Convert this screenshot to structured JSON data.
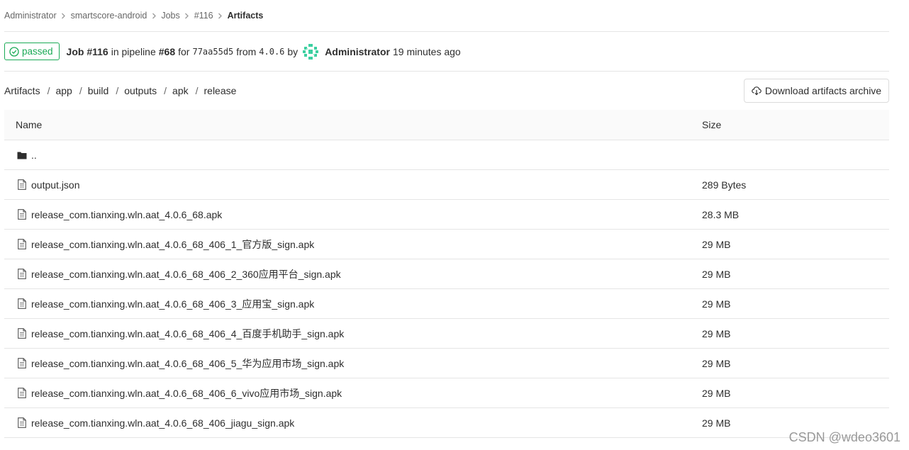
{
  "breadcrumb": [
    "Administrator",
    "smartscore-android",
    "Jobs",
    "#116",
    "Artifacts"
  ],
  "job": {
    "status": "passed",
    "job_label": "Job #116",
    "in_pipeline": "in pipeline",
    "pipeline": "#68",
    "for_text": "for",
    "commit": "77aa55d5",
    "from_text": "from",
    "ref": "4.0.6",
    "by_text": "by",
    "user": "Administrator",
    "time": "19 minutes ago"
  },
  "path": [
    "Artifacts",
    "app",
    "build",
    "outputs",
    "apk",
    "release"
  ],
  "download_label": "Download artifacts archive",
  "table": {
    "headers": {
      "name": "Name",
      "size": "Size"
    },
    "parent": "..",
    "rows": [
      {
        "name": "output.json",
        "size": "289 Bytes"
      },
      {
        "name": "release_com.tianxing.wln.aat_4.0.6_68.apk",
        "size": "28.3 MB"
      },
      {
        "name": "release_com.tianxing.wln.aat_4.0.6_68_406_1_官方版_sign.apk",
        "size": "29 MB"
      },
      {
        "name": "release_com.tianxing.wln.aat_4.0.6_68_406_2_360应用平台_sign.apk",
        "size": "29 MB"
      },
      {
        "name": "release_com.tianxing.wln.aat_4.0.6_68_406_3_应用宝_sign.apk",
        "size": "29 MB"
      },
      {
        "name": "release_com.tianxing.wln.aat_4.0.6_68_406_4_百度手机助手_sign.apk",
        "size": "29 MB"
      },
      {
        "name": "release_com.tianxing.wln.aat_4.0.6_68_406_5_华为应用市场_sign.apk",
        "size": "29 MB"
      },
      {
        "name": "release_com.tianxing.wln.aat_4.0.6_68_406_6_vivo应用市场_sign.apk",
        "size": "29 MB"
      },
      {
        "name": "release_com.tianxing.wln.aat_4.0.6_68_406_jiagu_sign.apk",
        "size": "29 MB"
      }
    ]
  },
  "watermark": "CSDN @wdeo3601",
  "icons": {
    "status": "check-circle-icon",
    "download": "cloud-download-icon",
    "folder": "folder-icon",
    "file": "file-text-icon",
    "chevron": "chevron-right-icon"
  },
  "colors": {
    "success": "#1aaa55",
    "text": "#2e2e2e",
    "border": "#e5e5e5"
  }
}
